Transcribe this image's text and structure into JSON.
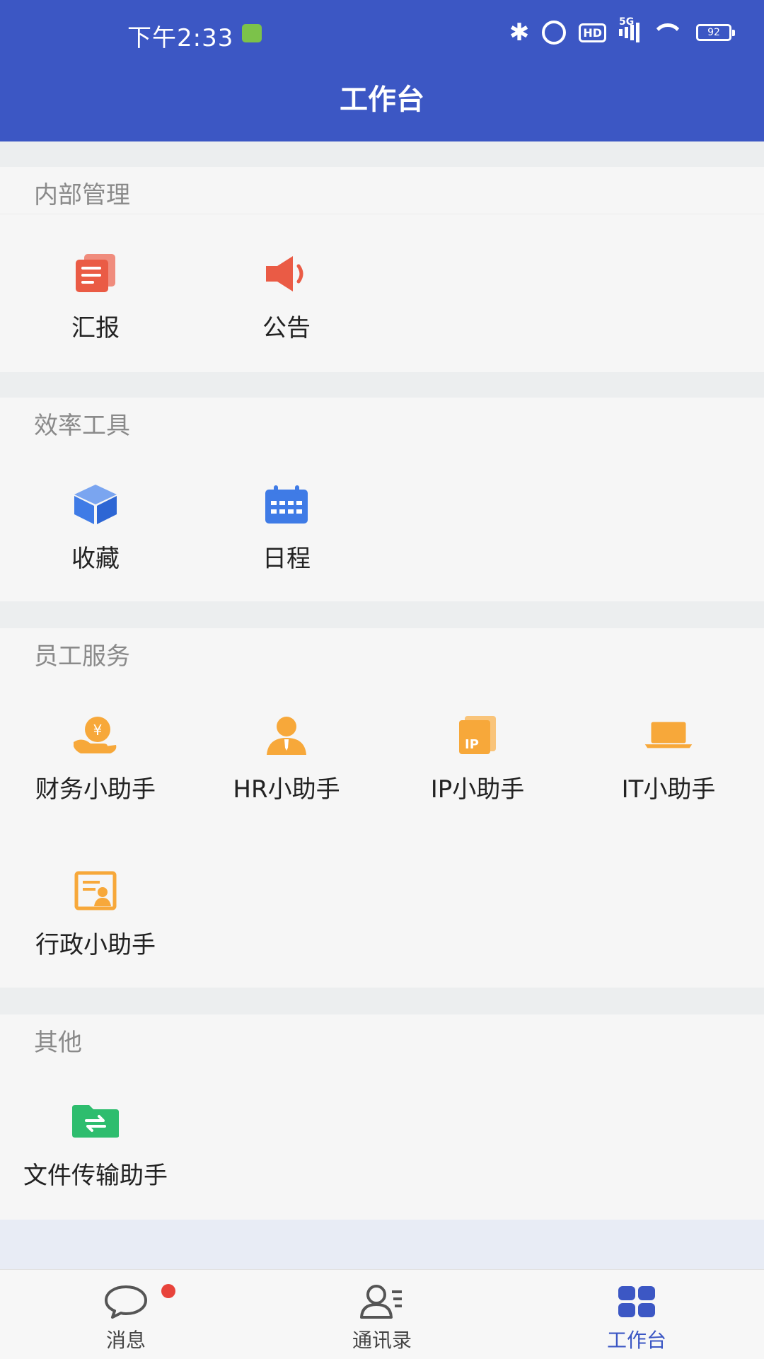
{
  "status_bar": {
    "time": "下午2:33",
    "network": "5G",
    "hd": "HD",
    "battery": "92"
  },
  "header": {
    "title": "工作台"
  },
  "sections": [
    {
      "title": "内部管理",
      "items": [
        {
          "label": "汇报",
          "icon": "report-icon",
          "color": "#ea5b45"
        },
        {
          "label": "公告",
          "icon": "megaphone-icon",
          "color": "#ea5b45"
        }
      ]
    },
    {
      "title": "效率工具",
      "items": [
        {
          "label": "收藏",
          "icon": "cube-icon",
          "color": "#3f7be6"
        },
        {
          "label": "日程",
          "icon": "calendar-icon",
          "color": "#3f7be6"
        }
      ]
    },
    {
      "title": "员工服务",
      "items": [
        {
          "label": "财务小助手",
          "icon": "money-hand-icon",
          "color": "#f7a83a"
        },
        {
          "label": "HR小助手",
          "icon": "person-icon",
          "color": "#f7a83a"
        },
        {
          "label": "IP小助手",
          "icon": "ip-doc-icon",
          "color": "#f7a83a"
        },
        {
          "label": "IT小助手",
          "icon": "laptop-icon",
          "color": "#f7a83a"
        },
        {
          "label": "行政小助手",
          "icon": "admin-doc-icon",
          "color": "#f7a83a"
        }
      ]
    },
    {
      "title": "其他",
      "items": [
        {
          "label": "文件传输助手",
          "icon": "folder-transfer-icon",
          "color": "#2ebd6e"
        }
      ]
    }
  ],
  "tabbar": {
    "tabs": [
      {
        "label": "消息",
        "icon": "chat-bubble-icon",
        "active": false,
        "badge": true
      },
      {
        "label": "通讯录",
        "icon": "contacts-icon",
        "active": false
      },
      {
        "label": "工作台",
        "icon": "grid-icon",
        "active": true
      }
    ]
  },
  "colors": {
    "primary": "#3c57c4",
    "badge": "#e8433b"
  }
}
